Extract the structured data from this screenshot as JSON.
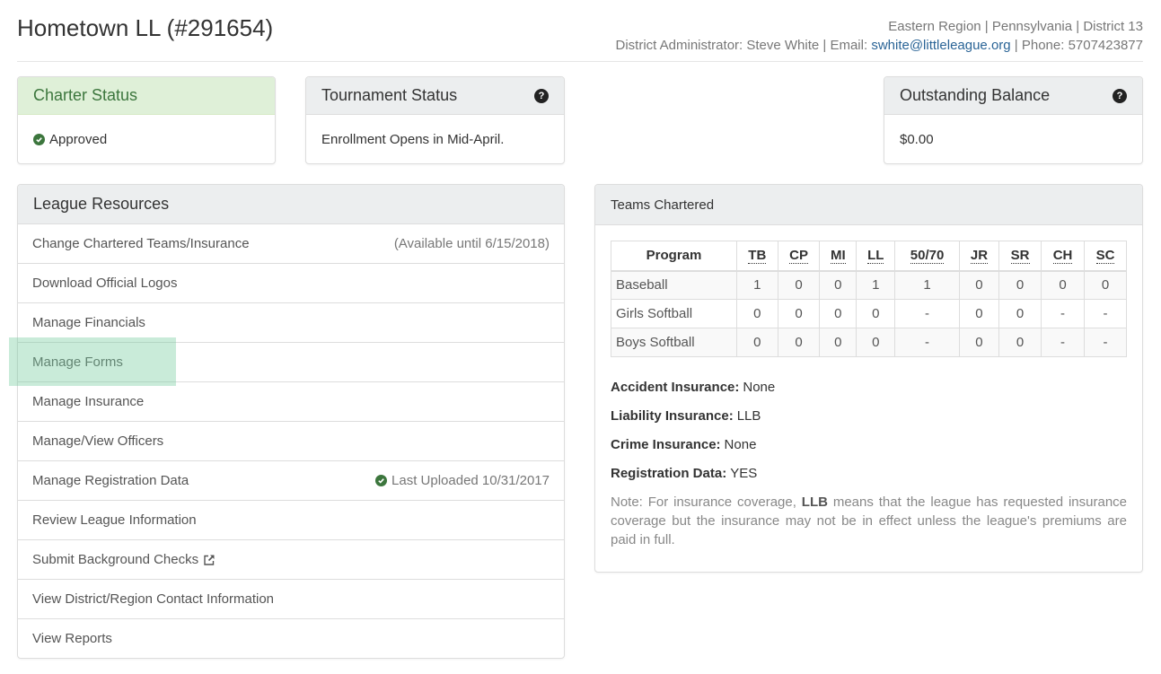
{
  "header": {
    "title": "Hometown LL (#291654)",
    "region_line": "Eastern Region | Pennsylvania | District 13",
    "admin_prefix": "District Administrator: Steve White | Email: ",
    "admin_email": "swhite@littleleague.org",
    "admin_suffix": " | Phone: 5707423877"
  },
  "charter_status": {
    "title": "Charter Status",
    "icon": "check-circle-icon",
    "value": "Approved"
  },
  "tournament_status": {
    "title": "Tournament Status",
    "help_icon": "question-circle-icon",
    "value": "Enrollment Opens in Mid-April."
  },
  "outstanding_balance": {
    "title": "Outstanding Balance",
    "help_icon": "question-circle-icon",
    "value": "$0.00"
  },
  "league_resources": {
    "title": "League Resources",
    "items": [
      {
        "label": "Change Chartered Teams/Insurance",
        "meta": "(Available until 6/15/2018)"
      },
      {
        "label": "Download Official Logos"
      },
      {
        "label": "Manage Financials"
      },
      {
        "label": "Manage Forms",
        "highlighted": true
      },
      {
        "label": "Manage Insurance"
      },
      {
        "label": "Manage/View Officers"
      },
      {
        "label": "Manage Registration Data",
        "meta": "Last Uploaded 10/31/2017",
        "meta_icon": "check-circle-icon"
      },
      {
        "label": "Review League Information"
      },
      {
        "label": "Submit Background Checks",
        "icon": "external-link-icon"
      },
      {
        "label": "View District/Region Contact Information"
      },
      {
        "label": "View Reports"
      }
    ]
  },
  "teams_chartered": {
    "title": "Teams Chartered",
    "columns": [
      "Program",
      "TB",
      "CP",
      "MI",
      "LL",
      "50/70",
      "JR",
      "SR",
      "CH",
      "SC"
    ],
    "rows": [
      [
        "Baseball",
        "1",
        "0",
        "0",
        "1",
        "1",
        "0",
        "0",
        "0",
        "0"
      ],
      [
        "Girls Softball",
        "0",
        "0",
        "0",
        "0",
        "-",
        "0",
        "0",
        "-",
        "-"
      ],
      [
        "Boys Softball",
        "0",
        "0",
        "0",
        "0",
        "-",
        "0",
        "0",
        "-",
        "-"
      ]
    ],
    "insurance": [
      {
        "label": "Accident Insurance:",
        "value": "None"
      },
      {
        "label": "Liability Insurance:",
        "value": "LLB"
      },
      {
        "label": "Crime Insurance:",
        "value": "None"
      },
      {
        "label": "Registration Data:",
        "value": "YES"
      }
    ],
    "note_prefix": "Note: For insurance coverage, ",
    "note_bold": "LLB",
    "note_suffix": " means that the league has requested insurance coverage but the insurance may not be in effect unless the league's premiums are paid in full."
  },
  "colors": {
    "success_bg": "#dff0d8",
    "success_text": "#3c763d",
    "link": "#2a6496",
    "panel_heading_bg": "#eceeef"
  }
}
